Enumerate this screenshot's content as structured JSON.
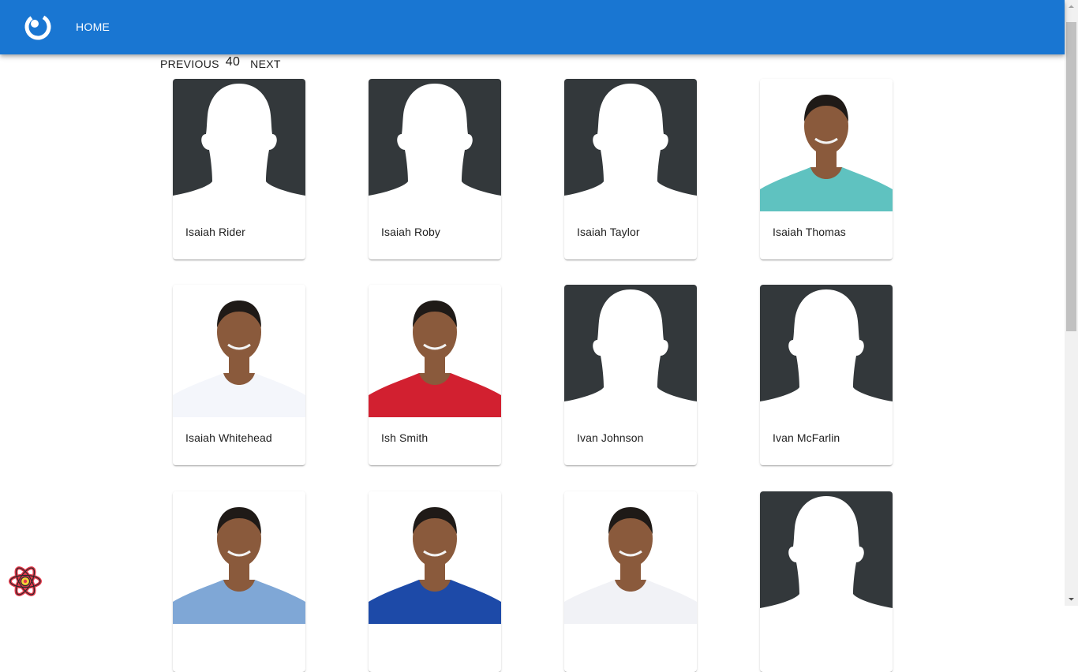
{
  "appbar": {
    "logo_icon": "circle-logo-icon",
    "home_label": "HOME",
    "color": "#1976d2"
  },
  "pager": {
    "previous_label": "PREVIOUS",
    "page": "40",
    "next_label": "NEXT"
  },
  "players": [
    {
      "name": "Isaiah Rider",
      "photo": "placeholder-silhouette"
    },
    {
      "name": "Isaiah Roby",
      "photo": "placeholder-silhouette"
    },
    {
      "name": "Isaiah Taylor",
      "photo": "placeholder-silhouette"
    },
    {
      "name": "Isaiah Thomas",
      "photo": "player-photo",
      "jersey": "#5fc2c0"
    },
    {
      "name": "Isaiah Whitehead",
      "photo": "player-photo",
      "jersey": "#f4f6fb"
    },
    {
      "name": "Ish Smith",
      "photo": "player-photo",
      "jersey": "#d22030"
    },
    {
      "name": "Ivan Johnson",
      "photo": "placeholder-silhouette"
    },
    {
      "name": "Ivan McFarlin",
      "photo": "placeholder-silhouette"
    },
    {
      "name": "",
      "photo": "player-photo",
      "jersey": "#7fa7d6"
    },
    {
      "name": "",
      "photo": "player-photo",
      "jersey": "#1d4aa8"
    },
    {
      "name": "",
      "photo": "player-photo",
      "jersey": "#f1f2f6"
    },
    {
      "name": "",
      "photo": "placeholder-silhouette"
    }
  ],
  "devtools_icon": "react-atom-icon"
}
